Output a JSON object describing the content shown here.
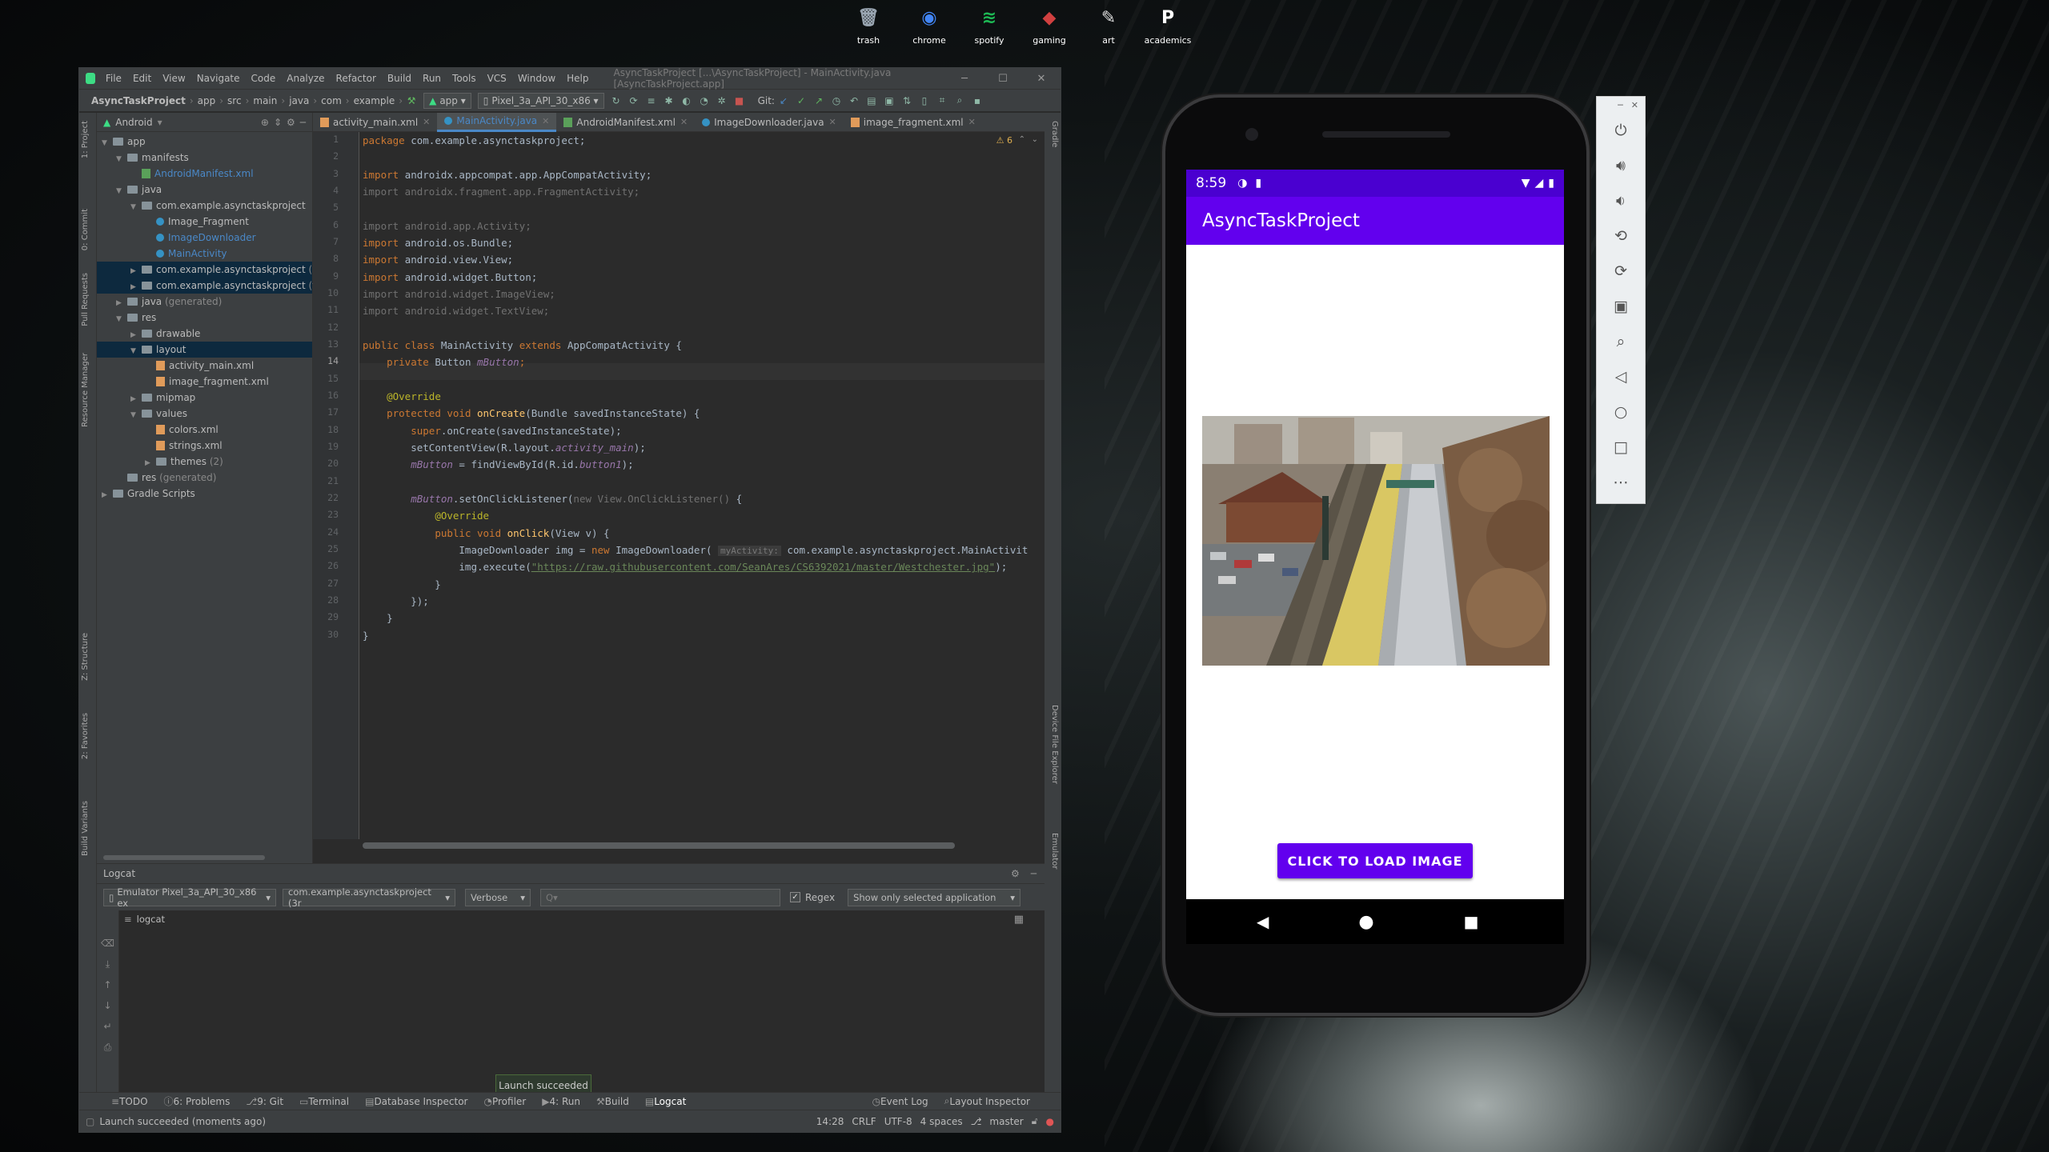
{
  "desktop": {
    "icons": [
      {
        "label": "trash",
        "icon": "trash-icon",
        "color": "#9aa6b2"
      },
      {
        "label": "chrome",
        "icon": "chrome-icon",
        "color": "#4285f4"
      },
      {
        "label": "spotify",
        "icon": "spotify-icon",
        "color": "#1db954"
      },
      {
        "label": "gaming",
        "icon": "gaming-icon",
        "color": "#d04040"
      },
      {
        "label": "art",
        "icon": "art-icon",
        "color": "#dddddd"
      },
      {
        "label": "academics",
        "icon": "academics-icon",
        "color": "#ffffff"
      }
    ]
  },
  "ide": {
    "menu": [
      "File",
      "Edit",
      "View",
      "Navigate",
      "Code",
      "Analyze",
      "Refactor",
      "Build",
      "Run",
      "Tools",
      "VCS",
      "Window",
      "Help"
    ],
    "title": "AsyncTaskProject [...\\AsyncTaskProject] - MainActivity.java [AsyncTaskProject.app]",
    "breadcrumbs": [
      "AsyncTaskProject",
      "app",
      "src",
      "main",
      "java",
      "com",
      "example"
    ],
    "run_config": "app",
    "device": "Pixel_3a_API_30_x86",
    "git_label": "Git:",
    "project_view": "Android",
    "tree": [
      {
        "label": "app",
        "depth": 0,
        "type": "folder",
        "open": true
      },
      {
        "label": "manifests",
        "depth": 1,
        "type": "folder",
        "open": true
      },
      {
        "label": "AndroidManifest.xml",
        "depth": 2,
        "type": "manifest",
        "color": "#4a88c7"
      },
      {
        "label": "java",
        "depth": 1,
        "type": "folder",
        "open": true
      },
      {
        "label": "com.example.asynctaskproject",
        "depth": 2,
        "type": "folder",
        "open": true
      },
      {
        "label": "Image_Fragment",
        "depth": 3,
        "type": "java"
      },
      {
        "label": "ImageDownloader",
        "depth": 3,
        "type": "java",
        "color": "#4a88c7"
      },
      {
        "label": "MainActivity",
        "depth": 3,
        "type": "java",
        "color": "#4a88c7"
      },
      {
        "label": "com.example.asynctaskproject",
        "depth": 2,
        "type": "folder",
        "suffix": " (andr",
        "closed": true,
        "sel": true
      },
      {
        "label": "com.example.asynctaskproject",
        "depth": 2,
        "type": "folder",
        "suffix": " (test)",
        "closed": true,
        "sel": true
      },
      {
        "label": "java",
        "depth": 1,
        "type": "folder",
        "suffix": " (generated)",
        "closed": true
      },
      {
        "label": "res",
        "depth": 1,
        "type": "folder",
        "open": true
      },
      {
        "label": "drawable",
        "depth": 2,
        "type": "folder",
        "closed": true
      },
      {
        "label": "layout",
        "depth": 2,
        "type": "folder",
        "open": true,
        "sel": true
      },
      {
        "label": "activity_main.xml",
        "depth": 3,
        "type": "xml"
      },
      {
        "label": "image_fragment.xml",
        "depth": 3,
        "type": "xml"
      },
      {
        "label": "mipmap",
        "depth": 2,
        "type": "folder",
        "closed": true
      },
      {
        "label": "values",
        "depth": 2,
        "type": "folder",
        "open": true
      },
      {
        "label": "colors.xml",
        "depth": 3,
        "type": "xml"
      },
      {
        "label": "strings.xml",
        "depth": 3,
        "type": "xml"
      },
      {
        "label": "themes",
        "depth": 3,
        "type": "folder",
        "suffix": " (2)",
        "closed": true
      },
      {
        "label": "res",
        "depth": 1,
        "type": "folder",
        "suffix": " (generated)"
      },
      {
        "label": "Gradle Scripts",
        "depth": 0,
        "type": "folder",
        "closed": true
      }
    ],
    "tabs": [
      {
        "label": "activity_main.xml",
        "type": "xml"
      },
      {
        "label": "MainActivity.java",
        "type": "java",
        "active": true
      },
      {
        "label": "AndroidManifest.xml",
        "type": "manifest"
      },
      {
        "label": "ImageDownloader.java",
        "type": "java"
      },
      {
        "label": "image_fragment.xml",
        "type": "xml"
      }
    ],
    "warnings": "⚠ 6",
    "code": [
      [
        [
          "kw",
          "package "
        ],
        [
          "",
          "com.example.asynctaskproject;"
        ]
      ],
      [],
      [
        [
          "kw",
          "import "
        ],
        [
          "",
          "androidx.appcompat.app.AppCompatActivity;"
        ]
      ],
      [
        [
          "gr",
          "import androidx.fragment.app.FragmentActivity;"
        ]
      ],
      [],
      [
        [
          "gr",
          "import android.app.Activity;"
        ]
      ],
      [
        [
          "kw",
          "import "
        ],
        [
          "",
          "android.os.Bundle;"
        ]
      ],
      [
        [
          "kw",
          "import "
        ],
        [
          "",
          "android.view.View;"
        ]
      ],
      [
        [
          "kw",
          "import "
        ],
        [
          "",
          "android.widget.Button;"
        ]
      ],
      [
        [
          "gr",
          "import android.widget.ImageView;"
        ]
      ],
      [
        [
          "gr",
          "import android.widget.TextView;"
        ]
      ],
      [],
      [
        [
          "kw",
          "public class "
        ],
        [
          "",
          "MainActivity "
        ],
        [
          "kw",
          "extends "
        ],
        [
          "",
          "AppCompatActivity {"
        ]
      ],
      [
        [
          "",
          "    "
        ],
        [
          "kw",
          "private "
        ],
        [
          "",
          "Button "
        ],
        [
          "it",
          "mButton"
        ],
        [
          "kw",
          ";"
        ]
      ],
      [],
      [
        [
          "",
          "    "
        ],
        [
          "an",
          "@Override"
        ]
      ],
      [
        [
          "",
          "    "
        ],
        [
          "kw",
          "protected void "
        ],
        [
          "fn",
          "onCreate"
        ],
        [
          "",
          "(Bundle savedInstanceState) {"
        ]
      ],
      [
        [
          "",
          "        "
        ],
        [
          "kw",
          "super"
        ],
        [
          "",
          "."
        ],
        [
          "",
          "onCreate(savedInstanceState);"
        ]
      ],
      [
        [
          "",
          "        "
        ],
        [
          "",
          "setContentView(R.layout."
        ],
        [
          "it",
          "activity_main"
        ],
        [
          "",
          ");"
        ]
      ],
      [
        [
          "",
          "        "
        ],
        [
          "it",
          "mButton"
        ],
        [
          "",
          " = findViewById(R.id."
        ],
        [
          "it",
          "button1"
        ],
        [
          "",
          ");"
        ]
      ],
      [],
      [
        [
          "",
          "        "
        ],
        [
          "it",
          "mButton"
        ],
        [
          "",
          ".setOnClickListener("
        ],
        [
          "gr",
          "new View.OnClickListener() "
        ],
        [
          "",
          "{"
        ]
      ],
      [
        [
          "",
          "            "
        ],
        [
          "an",
          "@Override"
        ]
      ],
      [
        [
          "",
          "            "
        ],
        [
          "kw",
          "public void "
        ],
        [
          "fn",
          "onClick"
        ],
        [
          "",
          "(View v) {"
        ]
      ],
      [
        [
          "",
          "                ImageDownloader img = "
        ],
        [
          "kw",
          "new "
        ],
        [
          "",
          "ImageDownloader( "
        ],
        [
          "hint",
          "myActivity:"
        ],
        [
          "",
          " com.example.asynctaskproject.MainActivit"
        ]
      ],
      [
        [
          "",
          "                img.execute("
        ],
        [
          "str",
          "\"https://raw.githubusercontent.com/SeanAres/CS6392021/master/Westchester.jpg\""
        ],
        [
          "",
          ");"
        ]
      ],
      [
        [
          "",
          "            }"
        ]
      ],
      [
        [
          "",
          "        });"
        ]
      ],
      [
        [
          "",
          "    }"
        ]
      ],
      [
        [
          "",
          "}"
        ]
      ]
    ],
    "logcat": {
      "title": "Logcat",
      "device": "Emulator Pixel_3a_API_30_x86 ex",
      "process": "com.example.asynctaskproject (3r",
      "level": "Verbose",
      "search_placeholder": "Q▾",
      "regex": "Regex",
      "filter": "Show only selected application",
      "sub": "logcat"
    },
    "toast": "Launch succeeded",
    "toolwindows": [
      "TODO",
      "6: Problems",
      "9: Git",
      "Terminal",
      "Database Inspector",
      "Profiler",
      "4: Run",
      "Build",
      "Logcat"
    ],
    "toolwindows_right": [
      "Event Log",
      "Layout Inspector"
    ],
    "status": {
      "message": "Launch succeeded (moments ago)",
      "position": "14:28",
      "line_sep": "CRLF",
      "encoding": "UTF-8",
      "indent": "4 spaces",
      "branch": "master"
    },
    "left_tabs": [
      "1: Project",
      "0: Commit",
      "Pull Requests",
      "Resource Manager",
      "Z: Structure",
      "2: Favorites",
      "Build Variants"
    ],
    "right_tabs": [
      "Gradle",
      "Device File Explorer",
      "Emulator"
    ]
  },
  "phone": {
    "time": "8:59",
    "app_title": "AsyncTaskProject",
    "button": "CLICK TO LOAD IMAGE"
  },
  "emulator_tools": [
    "power-icon",
    "volume-up-icon",
    "volume-down-icon",
    "rotate-left-icon",
    "rotate-right-icon",
    "camera-icon",
    "zoom-icon",
    "back-icon",
    "home-icon",
    "overview-icon",
    "more-icon"
  ]
}
